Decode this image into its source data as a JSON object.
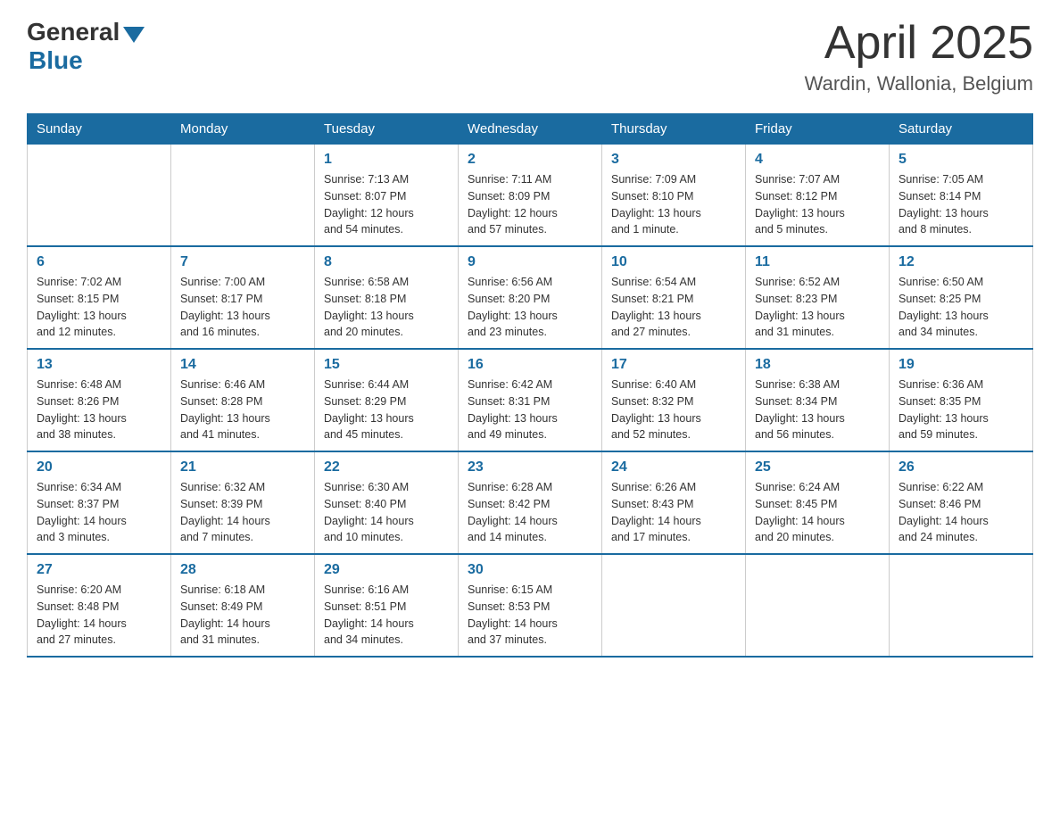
{
  "header": {
    "logo_general": "General",
    "logo_blue": "Blue",
    "title": "April 2025",
    "location": "Wardin, Wallonia, Belgium"
  },
  "days_of_week": [
    "Sunday",
    "Monday",
    "Tuesday",
    "Wednesday",
    "Thursday",
    "Friday",
    "Saturday"
  ],
  "weeks": [
    [
      {
        "day": "",
        "info": ""
      },
      {
        "day": "",
        "info": ""
      },
      {
        "day": "1",
        "info": "Sunrise: 7:13 AM\nSunset: 8:07 PM\nDaylight: 12 hours\nand 54 minutes."
      },
      {
        "day": "2",
        "info": "Sunrise: 7:11 AM\nSunset: 8:09 PM\nDaylight: 12 hours\nand 57 minutes."
      },
      {
        "day": "3",
        "info": "Sunrise: 7:09 AM\nSunset: 8:10 PM\nDaylight: 13 hours\nand 1 minute."
      },
      {
        "day": "4",
        "info": "Sunrise: 7:07 AM\nSunset: 8:12 PM\nDaylight: 13 hours\nand 5 minutes."
      },
      {
        "day": "5",
        "info": "Sunrise: 7:05 AM\nSunset: 8:14 PM\nDaylight: 13 hours\nand 8 minutes."
      }
    ],
    [
      {
        "day": "6",
        "info": "Sunrise: 7:02 AM\nSunset: 8:15 PM\nDaylight: 13 hours\nand 12 minutes."
      },
      {
        "day": "7",
        "info": "Sunrise: 7:00 AM\nSunset: 8:17 PM\nDaylight: 13 hours\nand 16 minutes."
      },
      {
        "day": "8",
        "info": "Sunrise: 6:58 AM\nSunset: 8:18 PM\nDaylight: 13 hours\nand 20 minutes."
      },
      {
        "day": "9",
        "info": "Sunrise: 6:56 AM\nSunset: 8:20 PM\nDaylight: 13 hours\nand 23 minutes."
      },
      {
        "day": "10",
        "info": "Sunrise: 6:54 AM\nSunset: 8:21 PM\nDaylight: 13 hours\nand 27 minutes."
      },
      {
        "day": "11",
        "info": "Sunrise: 6:52 AM\nSunset: 8:23 PM\nDaylight: 13 hours\nand 31 minutes."
      },
      {
        "day": "12",
        "info": "Sunrise: 6:50 AM\nSunset: 8:25 PM\nDaylight: 13 hours\nand 34 minutes."
      }
    ],
    [
      {
        "day": "13",
        "info": "Sunrise: 6:48 AM\nSunset: 8:26 PM\nDaylight: 13 hours\nand 38 minutes."
      },
      {
        "day": "14",
        "info": "Sunrise: 6:46 AM\nSunset: 8:28 PM\nDaylight: 13 hours\nand 41 minutes."
      },
      {
        "day": "15",
        "info": "Sunrise: 6:44 AM\nSunset: 8:29 PM\nDaylight: 13 hours\nand 45 minutes."
      },
      {
        "day": "16",
        "info": "Sunrise: 6:42 AM\nSunset: 8:31 PM\nDaylight: 13 hours\nand 49 minutes."
      },
      {
        "day": "17",
        "info": "Sunrise: 6:40 AM\nSunset: 8:32 PM\nDaylight: 13 hours\nand 52 minutes."
      },
      {
        "day": "18",
        "info": "Sunrise: 6:38 AM\nSunset: 8:34 PM\nDaylight: 13 hours\nand 56 minutes."
      },
      {
        "day": "19",
        "info": "Sunrise: 6:36 AM\nSunset: 8:35 PM\nDaylight: 13 hours\nand 59 minutes."
      }
    ],
    [
      {
        "day": "20",
        "info": "Sunrise: 6:34 AM\nSunset: 8:37 PM\nDaylight: 14 hours\nand 3 minutes."
      },
      {
        "day": "21",
        "info": "Sunrise: 6:32 AM\nSunset: 8:39 PM\nDaylight: 14 hours\nand 7 minutes."
      },
      {
        "day": "22",
        "info": "Sunrise: 6:30 AM\nSunset: 8:40 PM\nDaylight: 14 hours\nand 10 minutes."
      },
      {
        "day": "23",
        "info": "Sunrise: 6:28 AM\nSunset: 8:42 PM\nDaylight: 14 hours\nand 14 minutes."
      },
      {
        "day": "24",
        "info": "Sunrise: 6:26 AM\nSunset: 8:43 PM\nDaylight: 14 hours\nand 17 minutes."
      },
      {
        "day": "25",
        "info": "Sunrise: 6:24 AM\nSunset: 8:45 PM\nDaylight: 14 hours\nand 20 minutes."
      },
      {
        "day": "26",
        "info": "Sunrise: 6:22 AM\nSunset: 8:46 PM\nDaylight: 14 hours\nand 24 minutes."
      }
    ],
    [
      {
        "day": "27",
        "info": "Sunrise: 6:20 AM\nSunset: 8:48 PM\nDaylight: 14 hours\nand 27 minutes."
      },
      {
        "day": "28",
        "info": "Sunrise: 6:18 AM\nSunset: 8:49 PM\nDaylight: 14 hours\nand 31 minutes."
      },
      {
        "day": "29",
        "info": "Sunrise: 6:16 AM\nSunset: 8:51 PM\nDaylight: 14 hours\nand 34 minutes."
      },
      {
        "day": "30",
        "info": "Sunrise: 6:15 AM\nSunset: 8:53 PM\nDaylight: 14 hours\nand 37 minutes."
      },
      {
        "day": "",
        "info": ""
      },
      {
        "day": "",
        "info": ""
      },
      {
        "day": "",
        "info": ""
      }
    ]
  ]
}
